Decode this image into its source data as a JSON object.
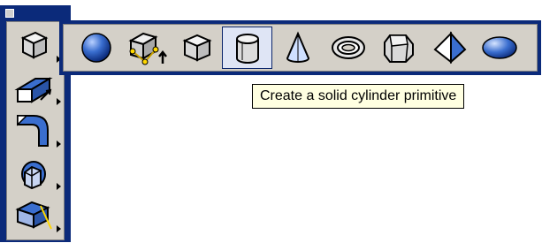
{
  "colors": {
    "toolbar_frame": "#0b2a7a",
    "toolbar_face": "#d4d0c8",
    "active_button": "#dfe5f5",
    "tooltip_bg": "#ffffe1",
    "icon_blue": "#3a6ecf"
  },
  "vertical_toolbar": {
    "buttons": [
      {
        "icon": "box-icon"
      },
      {
        "icon": "extrude-icon"
      },
      {
        "icon": "sweep-icon"
      },
      {
        "icon": "intersect-icon"
      },
      {
        "icon": "slice-icon"
      }
    ]
  },
  "solids_toolbar": {
    "buttons": [
      {
        "icon": "sphere-icon"
      },
      {
        "icon": "polysolid-icon"
      },
      {
        "icon": "box-icon"
      },
      {
        "icon": "cylinder-icon",
        "active": true
      },
      {
        "icon": "cone-icon"
      },
      {
        "icon": "torus-icon"
      },
      {
        "icon": "wedge-icon"
      },
      {
        "icon": "pyramid-icon"
      },
      {
        "icon": "ellipsoid-icon"
      }
    ]
  },
  "tooltip": {
    "text": "Create a solid cylinder primitive"
  }
}
